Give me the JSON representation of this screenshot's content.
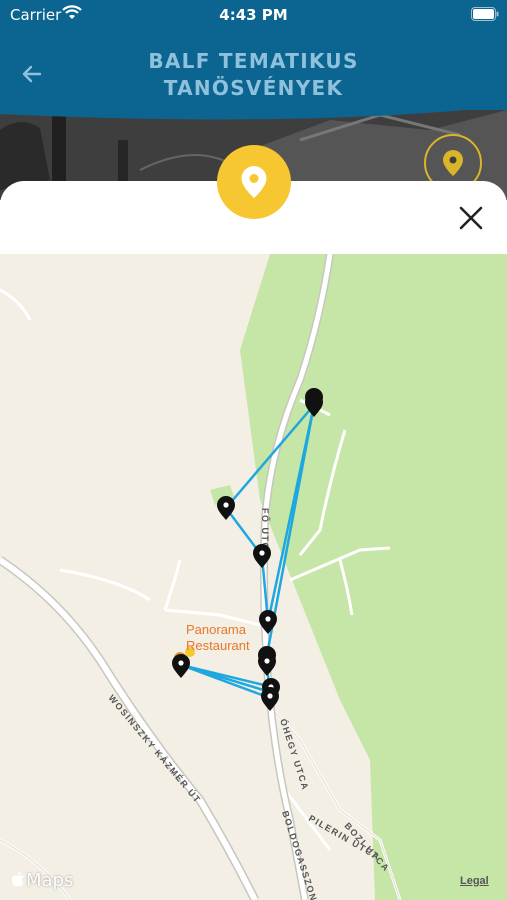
{
  "status_bar": {
    "carrier": "Carrier",
    "time": "4:43 PM",
    "wifi_icon": "wifi-icon",
    "battery_icon": "battery-icon"
  },
  "header": {
    "title_line1": "BALF TEMATIKUS",
    "title_line2": "TANÖSVÉNYEK",
    "back_icon": "back-arrow-icon",
    "background_color": "#0c6590",
    "title_color": "#8fc1dd"
  },
  "sheet": {
    "pin_icon": "location-pin-icon",
    "pin_color": "#f7c731",
    "close_icon": "close-icon"
  },
  "map": {
    "streets": [
      "FŐ UTCA",
      "ÓHEGY UTCA",
      "WOSINSZKY KÁZMÉR ÚT",
      "BOLDOGASSZONY UTCA",
      "PILERIN UTCA",
      "BOZI UTCA"
    ],
    "poi": {
      "line1": "Panorama",
      "line2": "Restaurant"
    },
    "route_color": "#1ea7e0",
    "park_color": "#c5e6a6",
    "attribution": "Maps",
    "legal": "Legal"
  }
}
